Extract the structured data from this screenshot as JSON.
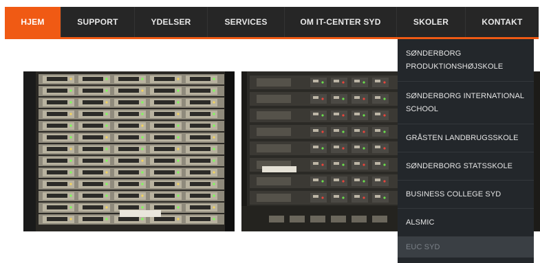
{
  "nav": {
    "items": [
      {
        "label": "HJEM",
        "active": true
      },
      {
        "label": "SUPPORT"
      },
      {
        "label": "YDELSER"
      },
      {
        "label": "SERVICES"
      },
      {
        "label": "OM IT-CENTER SYD"
      },
      {
        "label": "SKOLER"
      },
      {
        "label": "KONTAKT"
      }
    ],
    "active_color": "#f05a14",
    "bar_color": "#262626"
  },
  "dropdown": {
    "items": [
      {
        "label": "SØNDERBORG PRODUKTIONSHØJSKOLE"
      },
      {
        "label": "SØNDERBORG INTERNATIONAL SCHOOL"
      },
      {
        "label": "GRÅSTEN LANDBRUGSSKOLE"
      },
      {
        "label": "SØNDERBORG STATSSKOLE"
      },
      {
        "label": "BUSINESS COLLEGE SYD"
      },
      {
        "label": "ALSMIC"
      },
      {
        "label": "EUC SYD"
      }
    ],
    "background": "#23272b"
  },
  "photos": [
    {
      "name": "server-rack-photo-left"
    },
    {
      "name": "server-rack-photo-right"
    }
  ]
}
